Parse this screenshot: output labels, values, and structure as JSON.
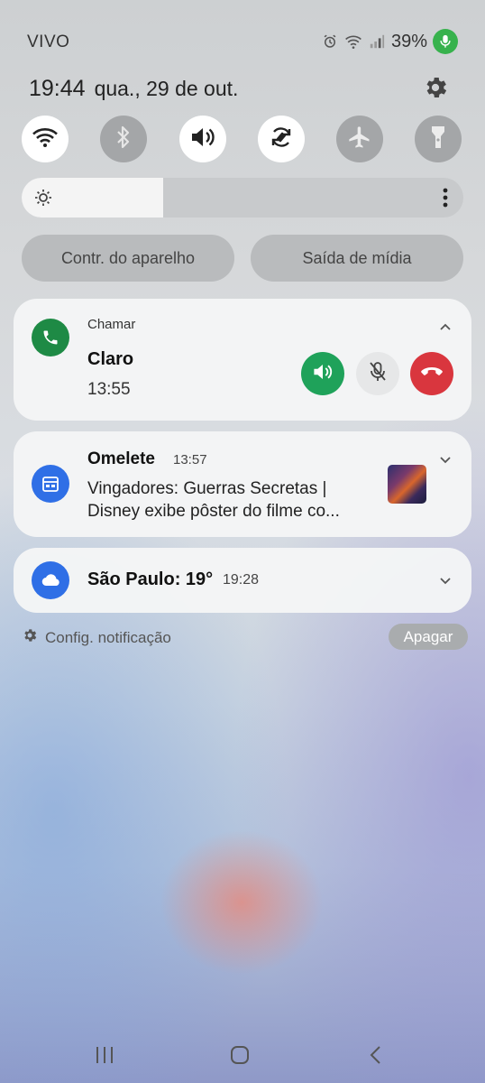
{
  "status_bar": {
    "carrier": "VIVO",
    "battery": "39%",
    "icons": [
      "alarm-icon",
      "wifi-icon",
      "signal-icon",
      "mic-active-icon"
    ]
  },
  "header": {
    "time": "19:44",
    "date": "qua., 29 de out."
  },
  "quick_toggles": [
    {
      "name": "wifi",
      "icon": "wifi-icon",
      "state": "on"
    },
    {
      "name": "bluetooth",
      "icon": "bluetooth-icon",
      "state": "off"
    },
    {
      "name": "sound",
      "icon": "volume-icon",
      "state": "on"
    },
    {
      "name": "auto-rotate",
      "icon": "rotate-icon",
      "state": "on"
    },
    {
      "name": "airplane",
      "icon": "airplane-icon",
      "state": "off"
    },
    {
      "name": "flashlight",
      "icon": "flashlight-icon",
      "state": "off"
    }
  ],
  "brightness": {
    "level_fraction": 0.32
  },
  "panel_buttons": {
    "device_control": "Contr. do aparelho",
    "media_output": "Saída de mídia"
  },
  "notifications": {
    "call": {
      "app_name": "Chamar",
      "caller": "Claro",
      "time": "13:55"
    },
    "omelete": {
      "app_name": "Omelete",
      "time": "13:57",
      "line1": "Vingadores: Guerras Secretas |",
      "line2": "Disney exibe pôster do filme co..."
    },
    "weather": {
      "title": "São Paulo: 19°",
      "time": "19:28"
    }
  },
  "footer": {
    "notification_settings": "Config. notificação",
    "clear": "Apagar"
  },
  "colors": {
    "call_green": "#1e8a45",
    "speaker_green": "#1fa25a",
    "hangup_red": "#d9363e",
    "app_blue": "#2f6fe6",
    "mic_indicator": "#37b24d"
  }
}
